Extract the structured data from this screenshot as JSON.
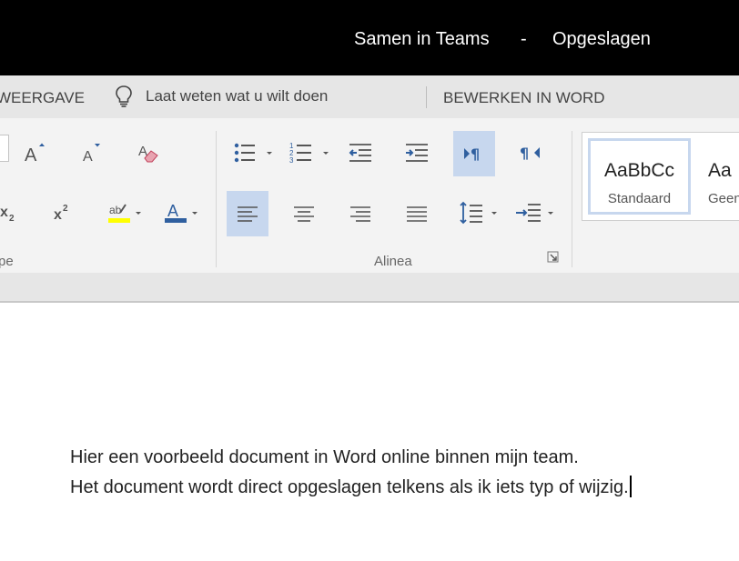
{
  "titlebar": {
    "document_name": "Samen in Teams",
    "separator": "-",
    "save_status": "Opgeslagen"
  },
  "menubar": {
    "view_tab": "WEERGAVE",
    "tell_me": "Laat weten wat u wilt doen",
    "edit_in_word": "BEWERKEN IN WORD"
  },
  "ribbon": {
    "groups": {
      "font_partial": "pe",
      "paragraph": "Alinea"
    },
    "styles": [
      {
        "preview": "AaBbCc",
        "name": "Standaard",
        "selected": true
      },
      {
        "preview": "Aa",
        "name": "Geen",
        "selected": false
      }
    ],
    "colors": {
      "highlight": "#ffff00",
      "font_color": "#2f5f9f",
      "active_button": "#c7d7ee"
    }
  },
  "document": {
    "lines": [
      "Hier een voorbeeld document in Word online binnen mijn team.",
      "Het document wordt direct opgeslagen telkens als ik iets typ of wijzig."
    ]
  }
}
